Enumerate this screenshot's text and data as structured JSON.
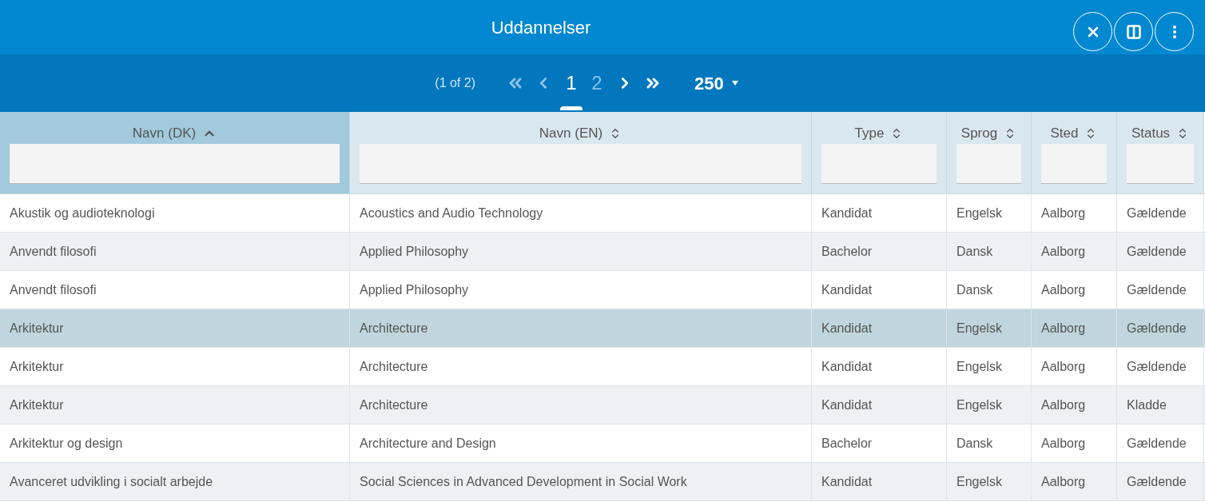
{
  "window": {
    "title": "Uddannelser"
  },
  "paginator": {
    "summary": "(1 of 2)",
    "pages": [
      {
        "label": "1",
        "selected": true
      },
      {
        "label": "2",
        "selected": false
      }
    ],
    "rows_per_page": "250"
  },
  "table": {
    "columns": [
      {
        "label": "Navn (DK)",
        "sorted": true
      },
      {
        "label": "Navn (EN)",
        "sorted": false
      },
      {
        "label": "Type",
        "sorted": false
      },
      {
        "label": "Sprog",
        "sorted": false
      },
      {
        "label": "Sted",
        "sorted": false
      },
      {
        "label": "Status",
        "sorted": false
      }
    ],
    "rows": [
      {
        "selected": false,
        "cells": [
          "Akustik og audioteknologi",
          "Acoustics and Audio Technology",
          "Kandidat",
          "Engelsk",
          "Aalborg",
          "Gældende"
        ]
      },
      {
        "selected": false,
        "cells": [
          "Anvendt filosofi",
          "Applied Philosophy",
          "Bachelor",
          "Dansk",
          "Aalborg",
          "Gældende"
        ]
      },
      {
        "selected": false,
        "cells": [
          "Anvendt filosofi",
          "Applied Philosophy",
          "Kandidat",
          "Dansk",
          "Aalborg",
          "Gældende"
        ]
      },
      {
        "selected": true,
        "cells": [
          "Arkitektur",
          "Architecture",
          "Kandidat",
          "Engelsk",
          "Aalborg",
          "Gældende"
        ]
      },
      {
        "selected": false,
        "cells": [
          "Arkitektur",
          "Architecture",
          "Kandidat",
          "Engelsk",
          "Aalborg",
          "Gældende"
        ]
      },
      {
        "selected": false,
        "cells": [
          "Arkitektur",
          "Architecture",
          "Kandidat",
          "Engelsk",
          "Aalborg",
          "Kladde"
        ]
      },
      {
        "selected": false,
        "cells": [
          "Arkitektur og design",
          "Architecture and Design",
          "Bachelor",
          "Dansk",
          "Aalborg",
          "Gældende"
        ]
      },
      {
        "selected": false,
        "cells": [
          "Avanceret udvikling i socialt arbejde",
          "Social Sciences in Advanced Development in Social Work",
          "Kandidat",
          "Engelsk",
          "Aalborg",
          "Gældende"
        ]
      }
    ]
  }
}
